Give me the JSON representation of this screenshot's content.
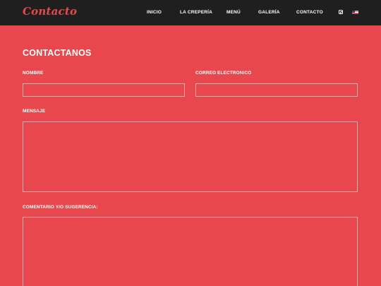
{
  "header": {
    "logo": "Contacto",
    "nav": [
      {
        "label": "INICIO"
      },
      {
        "label": "LA CREPERÍA"
      },
      {
        "label": "MENÚ"
      },
      {
        "label": "GALERÍA"
      },
      {
        "label": "CONTACTO"
      }
    ],
    "icons": [
      "instagram-icon",
      "us-flag-icon"
    ]
  },
  "form": {
    "heading": "CONTACTANOS",
    "nombre_label": "NOMBRE",
    "nombre_value": "",
    "correo_label": "CORREO ELECTRONICO",
    "correo_value": "",
    "mensaje_label": "MENSAJE",
    "mensaje_value": "",
    "comentario_label": "COMENTARIO Y/O SUGERENCIA:",
    "comentario_value": ""
  },
  "colors": {
    "background": "#e8484d",
    "topbar": "#1f1f1f",
    "text": "#ffffff"
  }
}
